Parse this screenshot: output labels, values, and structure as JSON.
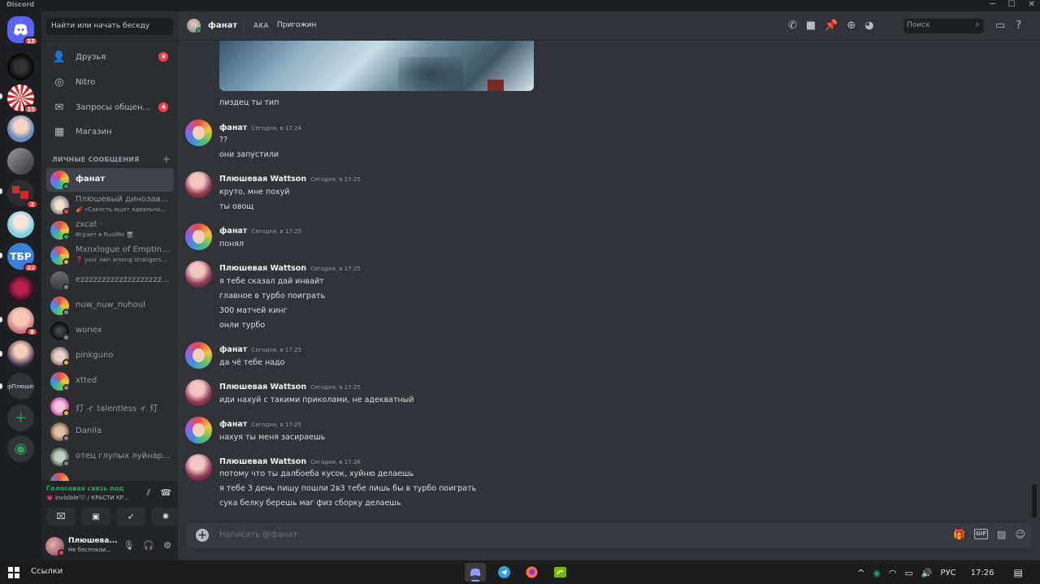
{
  "window": {
    "app_name": "Discord",
    "minimize": "─",
    "maximize": "☐",
    "close": "✕"
  },
  "servers": {
    "home_badge": "13",
    "badges": [
      "15",
      "2",
      "22",
      "8"
    ],
    "text_server_label": "ерПлюшев",
    "add_server": "+",
    "discover": "◉"
  },
  "sidebar": {
    "search_placeholder": "Найти или начать беседу",
    "nav": [
      {
        "label": "Друзья",
        "badge": "9"
      },
      {
        "label": "Nitro",
        "badge": ""
      },
      {
        "label": "Запросы общен...",
        "badge": "4"
      },
      {
        "label": "Магазин",
        "badge": ""
      }
    ],
    "dm_header": "ЛИЧНЫЕ СООБЩЕНИЯ",
    "dm_add": "+",
    "dms": [
      {
        "name": "фанат",
        "sub": ""
      },
      {
        "name": "Плюшевый динозав...",
        "sub": "🎻 «Сакость ищет идеально..."
      },
      {
        "name": "zxcat ·",
        "sub": "Играет в RustMe 🖥"
      },
      {
        "name": "Mxnxlogue of Emptin...",
        "sub": "❓ your own among strangers..."
      },
      {
        "name": "ezzzzzzzzzzzzzzzzzzz...",
        "sub": ""
      },
      {
        "name": "nuw_nuw_nuhoul",
        "sub": ""
      },
      {
        "name": "wonex",
        "sub": ""
      },
      {
        "name": "pinkguno",
        "sub": ""
      },
      {
        "name": "xtted",
        "sub": ""
      },
      {
        "name": "灯 ィ talentless ィ 灯",
        "sub": ""
      },
      {
        "name": "Danila",
        "sub": ""
      },
      {
        "name": "отец глупых луйнаров",
        "sub": ""
      },
      {
        "name": "...",
        "sub": ""
      }
    ]
  },
  "voice": {
    "title": "Голосовая связь под",
    "subtitle": "💗 invisible🖤 / КРАСТИ КР..."
  },
  "user": {
    "name": "Плюшева...",
    "status": "Не беспокои..."
  },
  "chat": {
    "header": {
      "name": "фанат",
      "aka_label": "AKA",
      "aka_value": "Пригожин",
      "search_placeholder": "Поиск"
    },
    "composer_placeholder": "Написать @фанат",
    "pre_line": "пиздец ты тип",
    "groups": [
      {
        "author": "фанат",
        "time": "Сегодня, в 17:24",
        "lines": [
          "??",
          "они запустили"
        ]
      },
      {
        "author": "Плюшевая Wattson",
        "time": "Сегодня, в 17:25",
        "lines": [
          "круто, мне похуй",
          "ты овощ"
        ]
      },
      {
        "author": "фанат",
        "time": "Сегодня, в 17:25",
        "lines": [
          "понял"
        ]
      },
      {
        "author": "Плюшевая Wattson",
        "time": "Сегодня, в 17:25",
        "lines": [
          "я тебе сказал дай инвайт",
          "главное в турбо поиграть",
          "300 матчей кинг",
          "онли турбо"
        ]
      },
      {
        "author": "фанат",
        "time": "Сегодня, в 17:25",
        "lines": [
          "да чё тебе надо"
        ]
      },
      {
        "author": "Плюшевая Wattson",
        "time": "Сегодня, в 17:25",
        "lines": [
          "иди нахуй с такими приколами, не адекватный"
        ]
      },
      {
        "author": "фанат",
        "time": "Сегодня, в 17:25",
        "lines": [
          "нахуя ты меня засираешь"
        ]
      },
      {
        "author": "Плюшевая Wattson",
        "time": "Сегодня, в 17:26",
        "lines": [
          "потому что ты далбоеба кусок, хуйню делаешь",
          "я тебе 3 день пишу пошли 2в3 тебе лишь бы в турбо поиграть",
          "сука белку берешь маг физ сборку делаешь"
        ]
      }
    ]
  },
  "taskbar": {
    "search_label": "Ссылки",
    "lang": "РУС",
    "time": "17:26"
  }
}
